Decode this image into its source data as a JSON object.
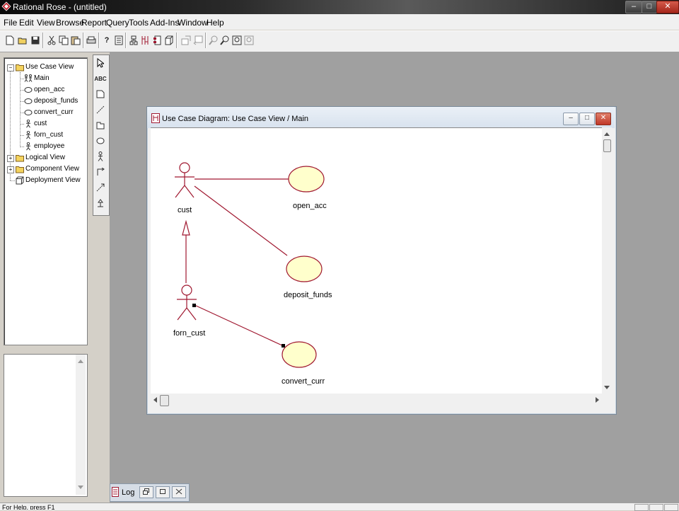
{
  "app": {
    "title": "Rational Rose - (untitled)",
    "window_buttons": [
      "–",
      "□",
      "✕"
    ]
  },
  "menu": [
    "File",
    "Edit",
    "View",
    "Browse",
    "Report",
    "Query",
    "Tools",
    "Add-Ins",
    "Window",
    "Help"
  ],
  "toolbar": {
    "icons": [
      "new-icon",
      "open-icon",
      "save-icon",
      "cut-icon",
      "copy-icon",
      "paste-icon",
      "print-icon",
      "context-help-icon",
      "documentation-window-icon",
      "browse-class-diagram-icon",
      "browse-interaction-diagram-icon",
      "browse-component-diagram-icon",
      "browse-deployment-diagram-icon",
      "browse-parent-icon",
      "browse-previous-diagram-icon",
      "zoom-in-icon",
      "zoom-out-icon",
      "fit-in-window-icon",
      "undo-fit-in-window-icon"
    ]
  },
  "browser": {
    "tree": [
      {
        "label": "Use Case View",
        "icon": "folder-icon",
        "level": 0,
        "expander": "−"
      },
      {
        "label": "Main",
        "icon": "use-case-diagram-icon",
        "level": 1
      },
      {
        "label": "open_acc",
        "icon": "use-case-icon",
        "level": 1
      },
      {
        "label": "deposit_funds",
        "icon": "use-case-icon",
        "level": 1
      },
      {
        "label": "convert_curr",
        "icon": "use-case-icon",
        "level": 1
      },
      {
        "label": "cust",
        "icon": "actor-icon",
        "level": 1
      },
      {
        "label": "forn_cust",
        "icon": "actor-icon",
        "level": 1
      },
      {
        "label": "employee",
        "icon": "actor-icon",
        "level": 1
      },
      {
        "label": "Logical View",
        "icon": "folder-icon",
        "level": 0,
        "expander": "+"
      },
      {
        "label": "Component View",
        "icon": "folder-icon",
        "level": 0,
        "expander": "+"
      },
      {
        "label": "Deployment View",
        "icon": "deployment-icon",
        "level": 0
      }
    ]
  },
  "toolbox": {
    "items": [
      "selection-arrow-icon",
      "text-box-icon",
      "note-icon",
      "anchor-note-icon",
      "package-icon",
      "use-case-tool-icon",
      "actor-tool-icon",
      "unidirectional-association-icon",
      "dependency-icon",
      "generalization-icon"
    ],
    "text_label": "ABC"
  },
  "diagram_window": {
    "title": "Use Case Diagram: Use Case View / Main",
    "buttons": [
      "–",
      "□",
      "✕"
    ],
    "actors": [
      {
        "name": "cust"
      },
      {
        "name": "forn_cust"
      }
    ],
    "use_cases": [
      {
        "name": "open_acc"
      },
      {
        "name": "deposit_funds"
      },
      {
        "name": "convert_curr"
      }
    ],
    "colors": {
      "line": "#a01830",
      "use_case_fill": "#ffffcc",
      "actor": "#a01830"
    }
  },
  "log": {
    "label": "Log"
  },
  "status": {
    "text": "For Help, press F1"
  }
}
